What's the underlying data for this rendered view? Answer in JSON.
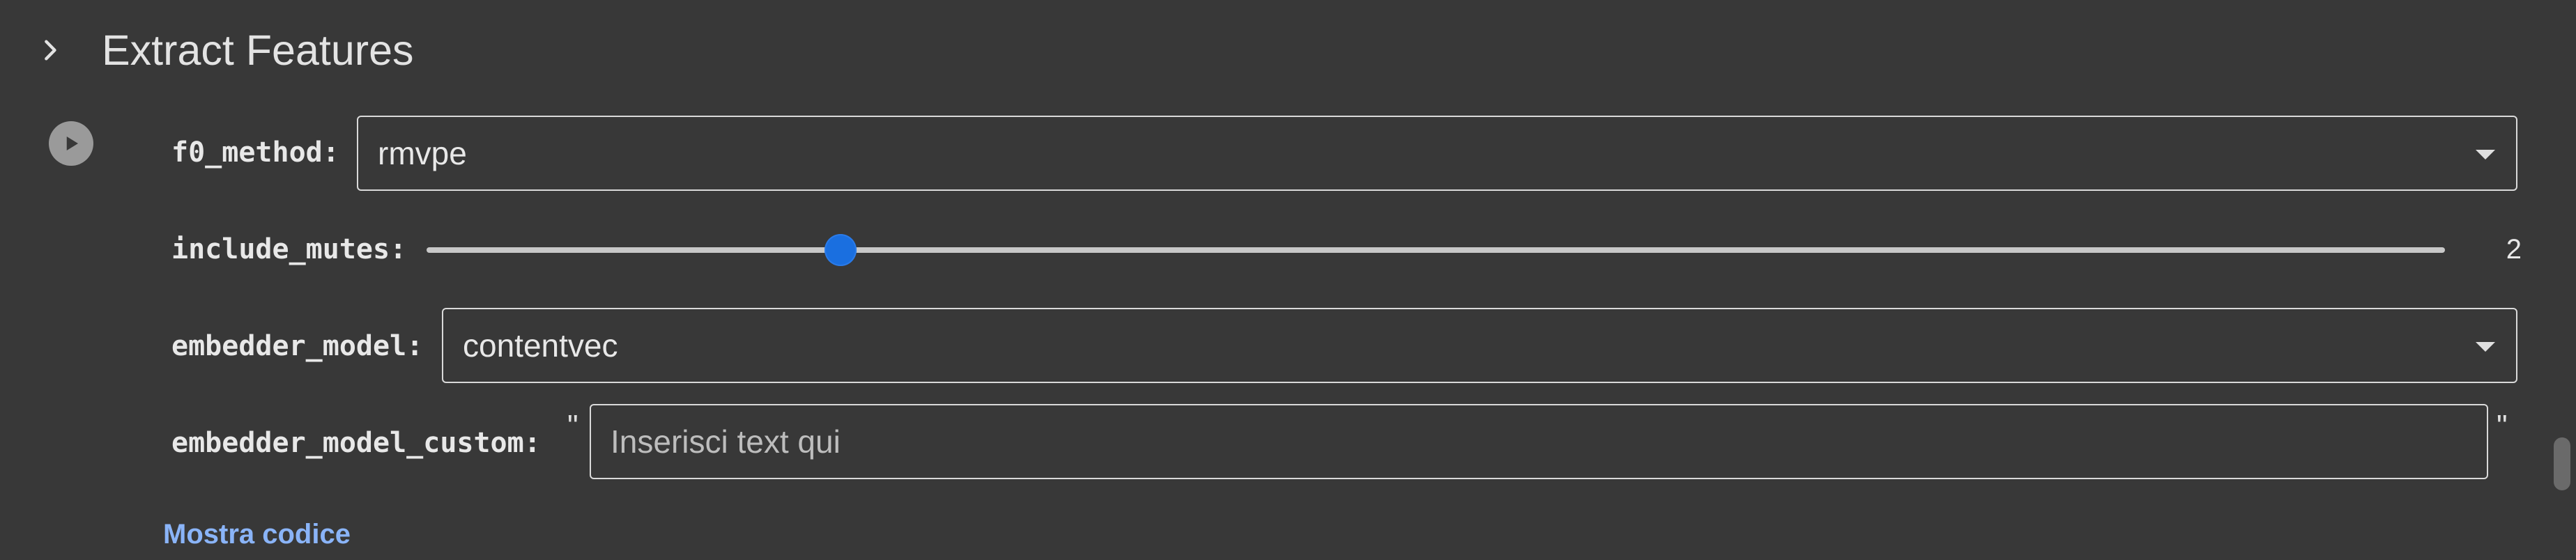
{
  "section": {
    "title": "Extract Features",
    "expand_icon": "chevron-right-icon",
    "run_icon": "play-circle-icon"
  },
  "params": {
    "f0_method": {
      "label": "f0_method:",
      "value": "rmvpe"
    },
    "include_mutes": {
      "label": "include_mutes:",
      "value": 2,
      "value_text": "2",
      "slider_fraction": 0.205
    },
    "embedder_model": {
      "label": "embedder_model:",
      "value": "contentvec"
    },
    "embedder_model_custom": {
      "label": "embedder_model_custom:",
      "value": "",
      "placeholder": "Inserisci text qui",
      "quote_open": "\"",
      "quote_close": "\""
    }
  },
  "footer": {
    "show_code": "Mostra codice"
  },
  "colors": {
    "background": "#383838",
    "accent": "#1a6fe0",
    "link": "#8ab4f8"
  }
}
